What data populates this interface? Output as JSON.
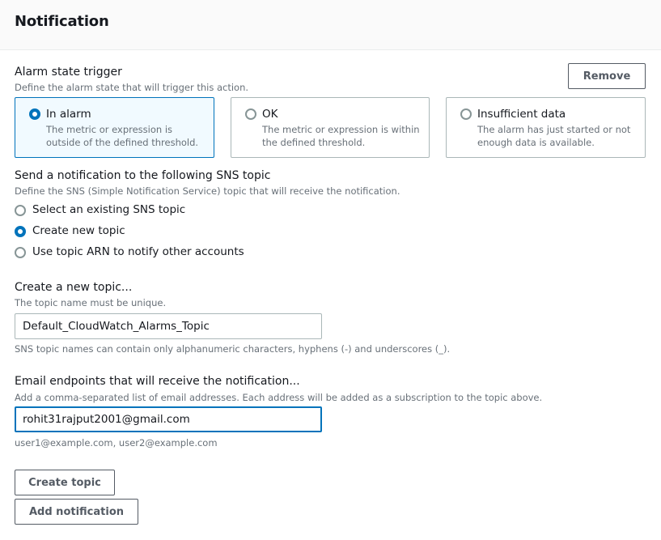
{
  "header": {
    "title": "Notification"
  },
  "alarm_trigger": {
    "label": "Alarm state trigger",
    "description": "Define the alarm state that will trigger this action.",
    "remove_label": "Remove",
    "options": [
      {
        "title": "In alarm",
        "description": "The metric or expression is outside of the defined threshold.",
        "selected": true
      },
      {
        "title": "OK",
        "description": "The metric or expression is within the defined threshold.",
        "selected": false
      },
      {
        "title": "Insufficient data",
        "description": "The alarm has just started or not enough data is available.",
        "selected": false
      }
    ]
  },
  "sns": {
    "label": "Send a notification to the following SNS topic",
    "description": "Define the SNS (Simple Notification Service) topic that will receive the notification.",
    "options": [
      {
        "label": "Select an existing SNS topic",
        "selected": false
      },
      {
        "label": "Create new topic",
        "selected": true
      },
      {
        "label": "Use topic ARN to notify other accounts",
        "selected": false
      }
    ]
  },
  "new_topic": {
    "label": "Create a new topic...",
    "description": "The topic name must be unique.",
    "value": "Default_CloudWatch_Alarms_Topic",
    "constraint": "SNS topic names can contain only alphanumeric characters, hyphens (-) and underscores (_)."
  },
  "email": {
    "label": "Email endpoints that will receive the notification...",
    "description": "Add a comma-separated list of email addresses. Each address will be added as a subscription to the topic above.",
    "value": "rohit31rajput2001@gmail.com",
    "hint": "user1@example.com, user2@example.com"
  },
  "actions": {
    "create_topic_label": "Create topic",
    "add_notification_label": "Add notification"
  },
  "colors": {
    "accent": "#0073bb",
    "text": "#16191f",
    "secondary_text": "#687078"
  }
}
